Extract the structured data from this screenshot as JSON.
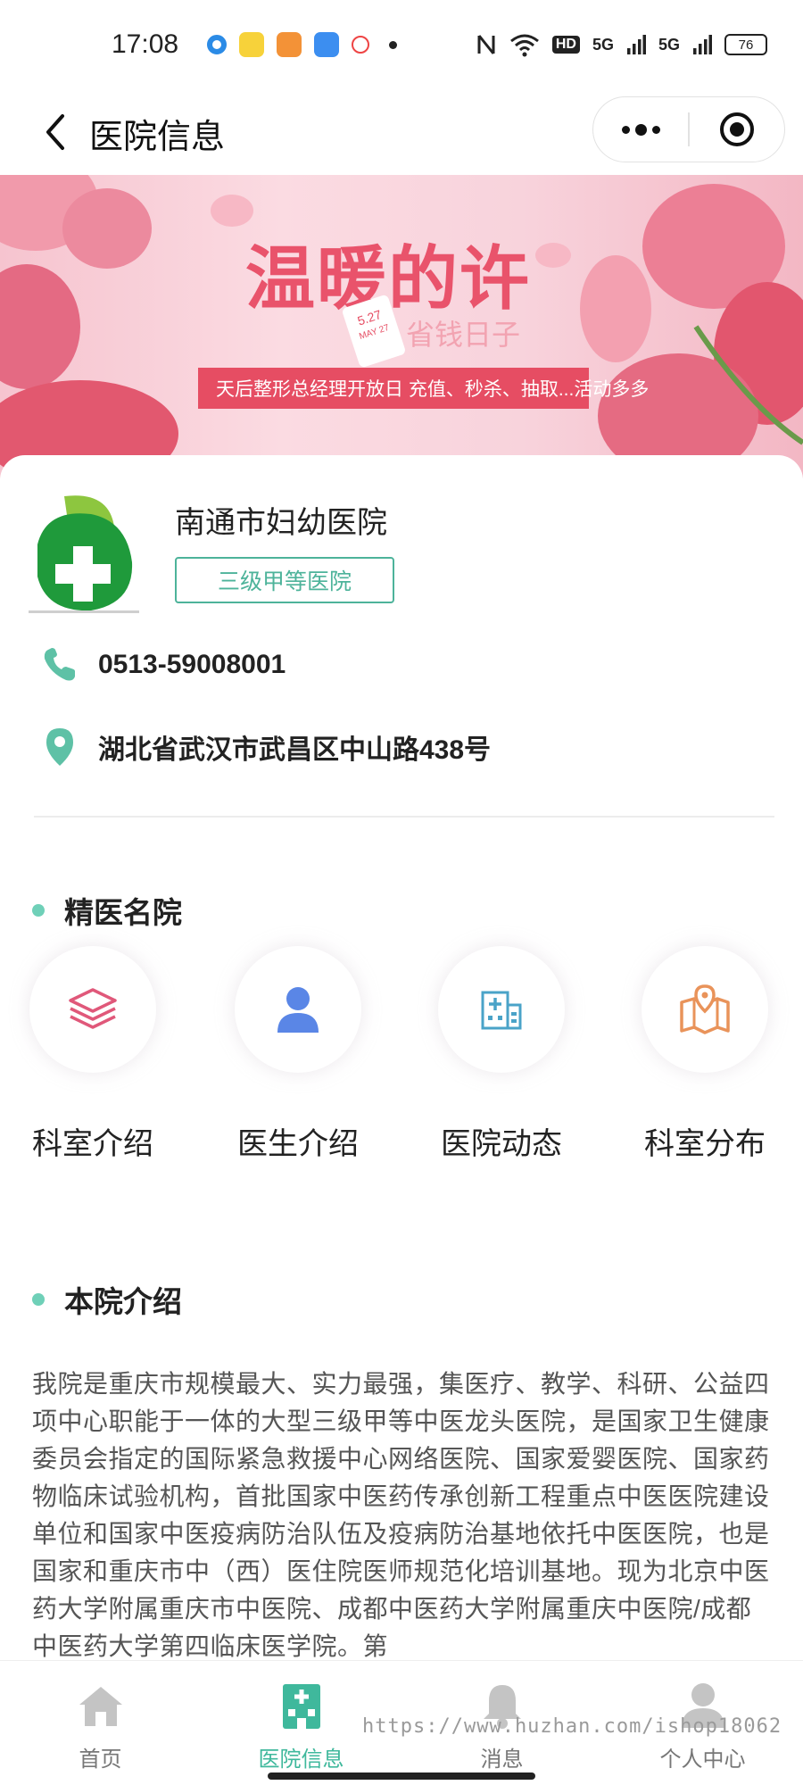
{
  "status_bar": {
    "time": "17:08",
    "network_5g_1": "5G",
    "network_5g_2": "5G",
    "hd_label": "HD",
    "battery": "76"
  },
  "nav": {
    "title": "医院信息",
    "back_icon": "chevron-left-icon",
    "more_icon": "more-dots-icon",
    "close_icon": "target-circle-icon"
  },
  "banner": {
    "headline": "温暖的许",
    "subline": "省钱日子",
    "tag_date": "5.27",
    "tag_month": "MAY 27",
    "strip_text": "天后整形总经理开放日 充值、秒杀、抽取...活动多多"
  },
  "hospital": {
    "name": "南通市妇幼医院",
    "level": "三级甲等医院",
    "phone": "0513-59008001",
    "address": "湖北省武汉市武昌区中山路438号",
    "accent_color": "#4db39a"
  },
  "sections": {
    "featured_title": "精医名院",
    "intro_title": "本院介绍"
  },
  "features": [
    {
      "label": "科室介绍",
      "icon": "layers-icon",
      "color": "#e0587a"
    },
    {
      "label": "医生介绍",
      "icon": "person-icon",
      "color": "#5a86e6"
    },
    {
      "label": "医院动态",
      "icon": "hospital-building-icon",
      "color": "#4aa3c8"
    },
    {
      "label": "科室分布",
      "icon": "map-pin-icon",
      "color": "#e9935a"
    }
  ],
  "intro_text": "我院是重庆市规模最大、实力最强，集医疗、教学、科研、公益四项中心职能于一体的大型三级甲等中医龙头医院，是国家卫生健康委员会指定的国际紧急救援中心网络医院、国家爱婴医院、国家药物临床试验机构，首批国家中医药传承创新工程重点中医医院建设单位和国家中医疫病防治队伍及疫病防治基地依托中医医院，也是国家和重庆市中（西）医住院医师规范化培训基地。现为北京中医药大学附属重庆市中医院、成都中医药大学附属重庆中医院/成都中医药大学第四临床医学院。第",
  "tabs": [
    {
      "label": "首页",
      "icon": "home-icon"
    },
    {
      "label": "医院信息",
      "icon": "hospital-icon"
    },
    {
      "label": "消息",
      "icon": "bell-icon"
    },
    {
      "label": "个人中心",
      "icon": "user-icon"
    }
  ],
  "active_tab_color": "#3fb89c",
  "watermark": "https://www.huzhan.com/ishop18062"
}
